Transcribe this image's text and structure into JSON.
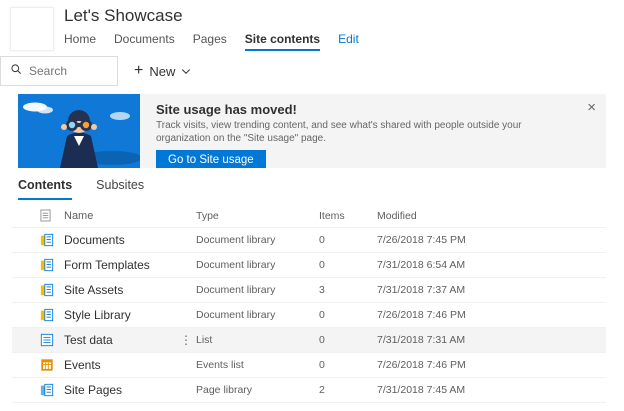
{
  "site": {
    "title": "Let's Showcase"
  },
  "nav": {
    "items": [
      {
        "label": "Home"
      },
      {
        "label": "Documents"
      },
      {
        "label": "Pages"
      },
      {
        "label": "Site contents"
      },
      {
        "label": "Edit"
      }
    ]
  },
  "command_bar": {
    "search_placeholder": "Search",
    "new_label": "New"
  },
  "banner": {
    "title": "Site usage has moved!",
    "description": "Track visits, view trending content, and see what's shared with people outside your organization on the \"Site usage\" page.",
    "button_label": "Go to Site usage"
  },
  "tabs": [
    {
      "label": "Contents"
    },
    {
      "label": "Subsites"
    }
  ],
  "table": {
    "columns": [
      "Name",
      "Type",
      "Items",
      "Modified"
    ],
    "rows": [
      {
        "icon": "document-library",
        "name": "Documents",
        "type": "Document library",
        "items": "0",
        "modified": "7/26/2018 7:45 PM"
      },
      {
        "icon": "document-library",
        "name": "Form Templates",
        "type": "Document library",
        "items": "0",
        "modified": "7/31/2018 6:54 AM"
      },
      {
        "icon": "document-library",
        "name": "Site Assets",
        "type": "Document library",
        "items": "3",
        "modified": "7/31/2018 7:37 AM"
      },
      {
        "icon": "document-library",
        "name": "Style Library",
        "type": "Document library",
        "items": "0",
        "modified": "7/26/2018 7:46 PM"
      },
      {
        "icon": "list",
        "name": "Test data",
        "type": "List",
        "items": "0",
        "modified": "7/31/2018 7:31 AM",
        "selected": true,
        "menu": true
      },
      {
        "icon": "events",
        "name": "Events",
        "type": "Events list",
        "items": "0",
        "modified": "7/26/2018 7:46 PM"
      },
      {
        "icon": "page-library",
        "name": "Site Pages",
        "type": "Page library",
        "items": "2",
        "modified": "7/31/2018 7:45 AM"
      }
    ]
  },
  "icons": {
    "close": "×",
    "row_menu": "⋮",
    "plus": "+"
  },
  "colors": {
    "accent": "#0078d7",
    "banner_bg": "#f4f4f4",
    "banner_image_bg": "#1079d8"
  }
}
